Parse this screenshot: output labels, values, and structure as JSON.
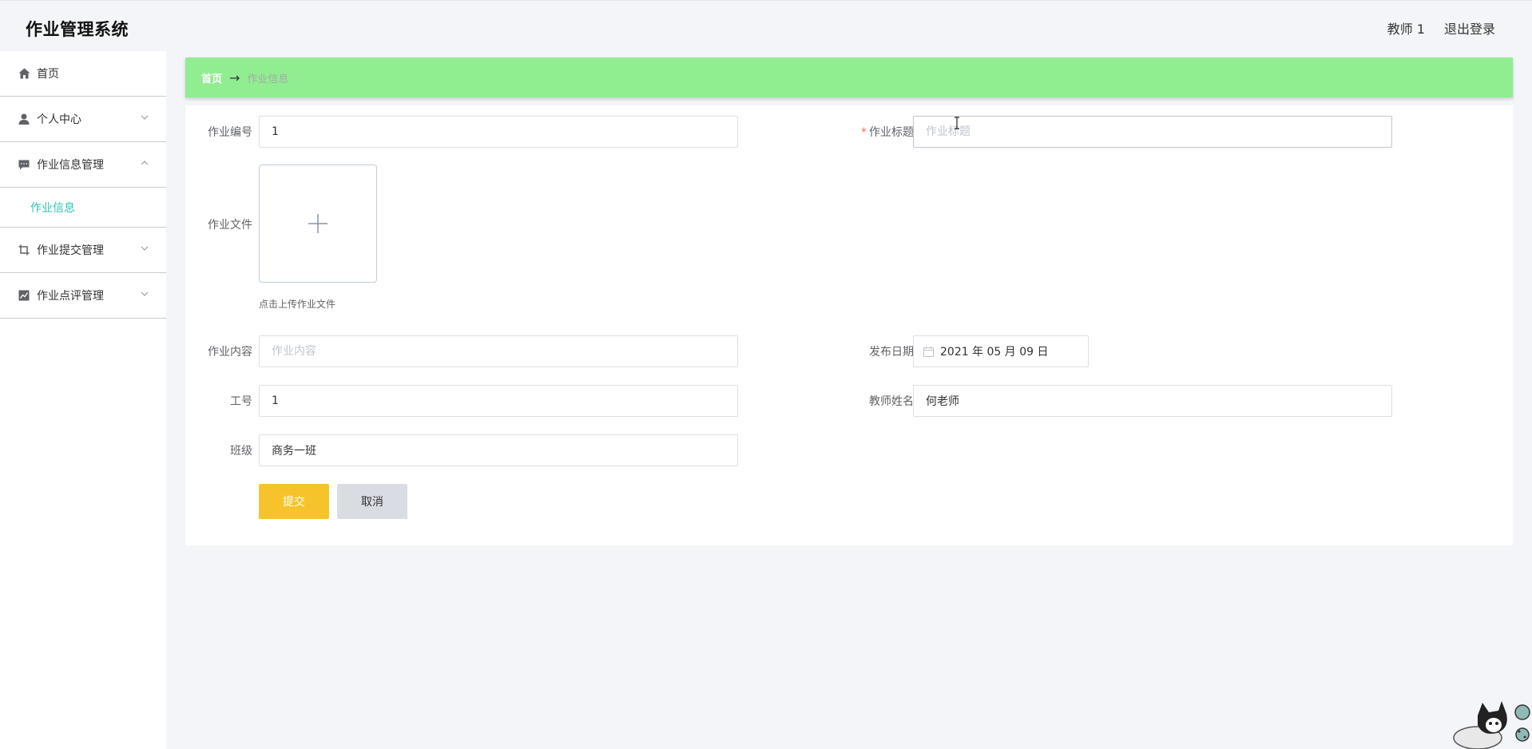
{
  "header": {
    "title": "作业管理系统",
    "user": "教师 1",
    "logout": "退出登录"
  },
  "sidebar": {
    "items": [
      {
        "label": "首页",
        "icon": "home-icon"
      },
      {
        "label": "个人中心",
        "icon": "user-icon"
      },
      {
        "label": "作业信息管理",
        "icon": "chat-icon"
      },
      {
        "label": "作业提交管理",
        "icon": "crop-icon"
      },
      {
        "label": "作业点评管理",
        "icon": "chart-icon"
      }
    ],
    "sub_item": "作业信息",
    "active_color": "#2ec4b0"
  },
  "breadcrumb": {
    "home": "首页",
    "separator": "→",
    "current": "作业信息",
    "bar_color": "#90ee90"
  },
  "form": {
    "hw_number": {
      "label": "作业编号",
      "value": "1"
    },
    "hw_title": {
      "label": "作业标题",
      "required_mark": "*",
      "placeholder": "作业标题",
      "value": ""
    },
    "hw_file": {
      "label": "作业文件",
      "tip": "点击上传作业文件"
    },
    "hw_content": {
      "label": "作业内容",
      "placeholder": "作业内容",
      "value": ""
    },
    "publish_date": {
      "label": "发布日期",
      "value": "2021 年 05 月 09 日"
    },
    "staff_id": {
      "label": "工号",
      "value": "1"
    },
    "teacher_name": {
      "label": "教师姓名",
      "value": "何老师"
    },
    "class_name": {
      "label": "班级",
      "value": "商务一班"
    }
  },
  "buttons": {
    "submit": "提交",
    "cancel": "取消",
    "submit_color": "#f7c32b"
  }
}
